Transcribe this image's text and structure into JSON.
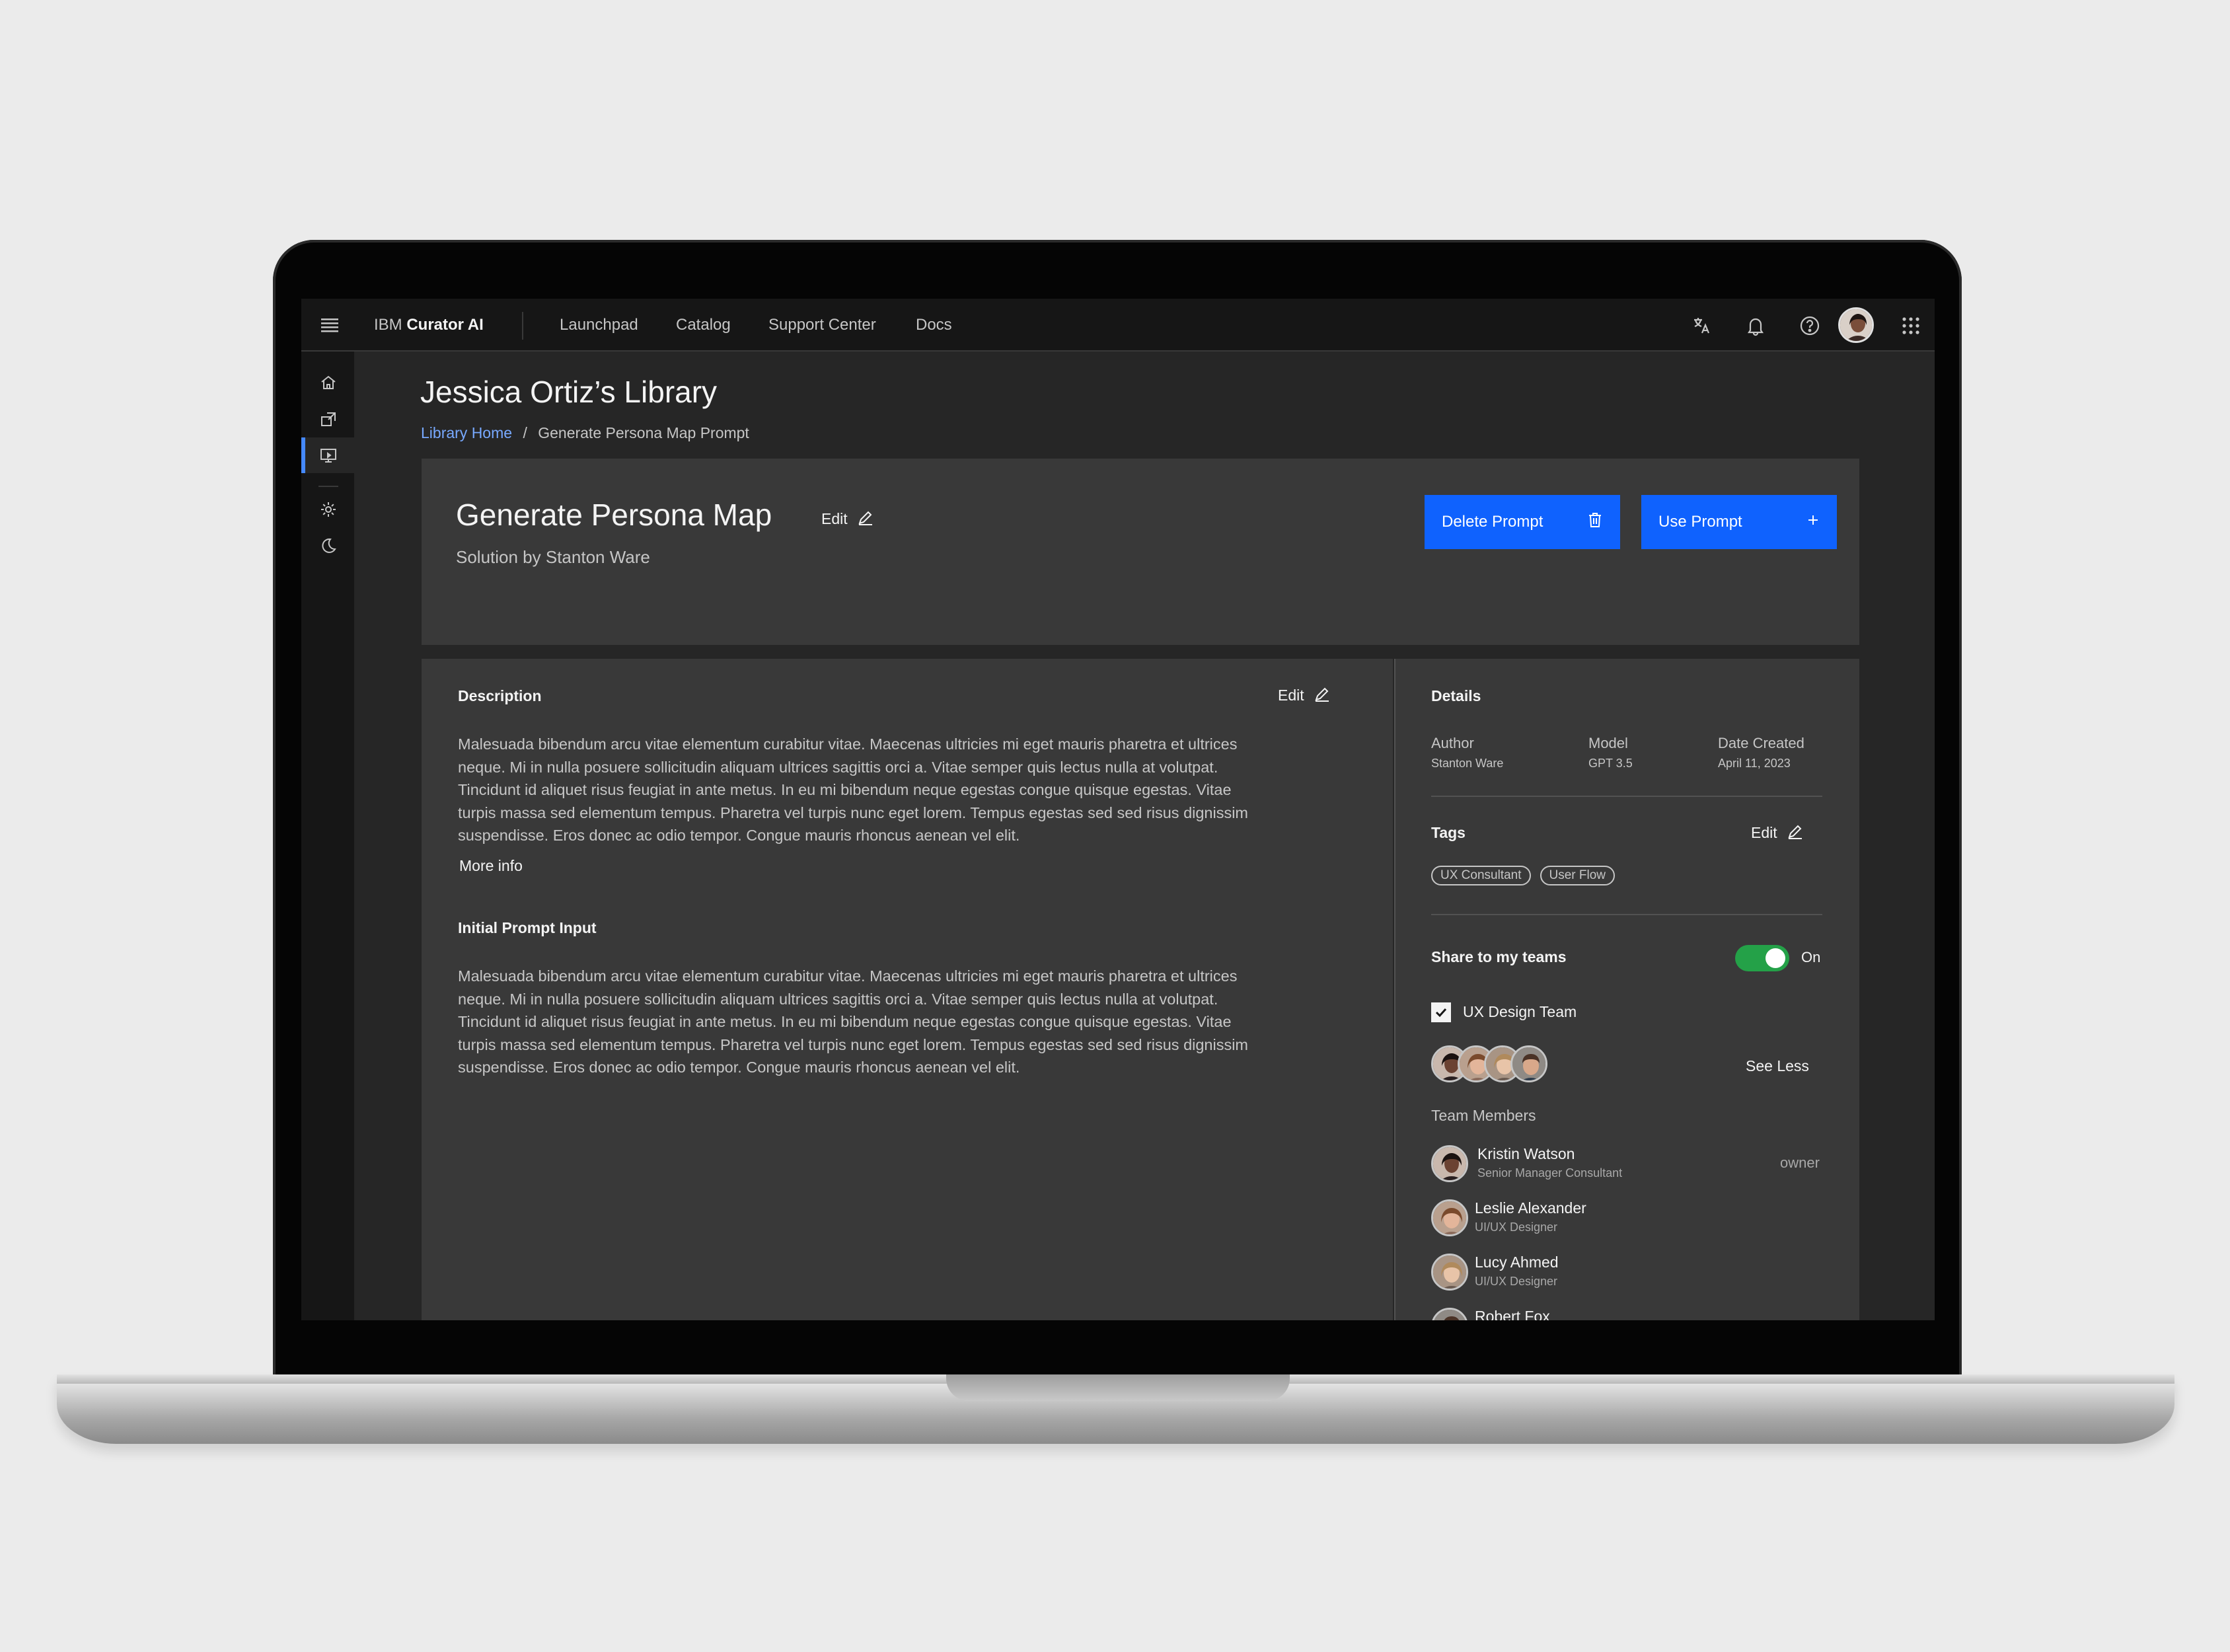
{
  "header": {
    "brand_prefix": "IBM",
    "brand_name": "Curator AI",
    "nav": [
      "Launchpad",
      "Catalog",
      "Support Center",
      "Docs"
    ]
  },
  "page": {
    "title": "Jessica Ortiz’s Library",
    "breadcrumb_home": "Library Home",
    "breadcrumb_sep": "/",
    "breadcrumb_current": "Generate Persona Map Prompt"
  },
  "prompt": {
    "title": "Generate Persona Map",
    "edit_label": "Edit",
    "subtitle": "Solution by Stanton Ware",
    "delete_label": "Delete Prompt",
    "use_label": "Use Prompt"
  },
  "description": {
    "heading": "Description",
    "edit_label": "Edit",
    "body": "Malesuada bibendum arcu vitae elementum curabitur vitae. Maecenas ultricies mi eget mauris pharetra et ultrices neque. Mi in nulla posuere sollicitudin aliquam ultrices sagittis orci a. Vitae semper quis lectus nulla at volutpat. Tincidunt id aliquet risus feugiat in ante metus. In eu mi bibendum neque egestas congue quisque egestas. Vitae turpis massa sed elementum tempus. Pharetra vel turpis nunc eget lorem. Tempus egestas sed sed risus dignissim suspendisse. Eros donec ac odio tempor. Congue mauris rhoncus aenean vel elit.",
    "more_info": "More info",
    "initial_heading": "Initial Prompt Input",
    "initial_body": "Malesuada bibendum arcu vitae elementum curabitur vitae. Maecenas ultricies mi eget mauris pharetra et ultrices neque. Mi in nulla posuere sollicitudin aliquam ultrices sagittis orci a. Vitae semper quis lectus nulla at volutpat. Tincidunt id aliquet risus feugiat in ante metus. In eu mi bibendum neque egestas congue quisque egestas. Vitae turpis massa sed elementum tempus. Pharetra vel turpis nunc eget lorem. Tempus egestas sed sed risus dignissim suspendisse. Eros donec ac odio tempor. Congue mauris rhoncus aenean vel elit."
  },
  "details": {
    "heading": "Details",
    "author_label": "Author",
    "author_value": "Stanton Ware",
    "model_label": "Model",
    "model_value": "GPT 3.5",
    "date_label": "Date Created",
    "date_value": "April 11, 2023",
    "tags_heading": "Tags",
    "tags_edit": "Edit",
    "tags": [
      "UX Consultant",
      "User Flow"
    ],
    "share_label": "Share to my teams",
    "share_state": "On",
    "team_name": "UX Design Team",
    "see_less": "See Less",
    "members_heading": "Team Members",
    "members": [
      {
        "name": "Kristin Watson",
        "role": "Senior Manager Consultant",
        "badge": "owner"
      },
      {
        "name": "Leslie Alexander",
        "role": "UI/UX Designer"
      },
      {
        "name": "Lucy Ahmed",
        "role": "UI/UX Designer"
      },
      {
        "name": "Robert Fox",
        "role": ""
      }
    ]
  },
  "colors": {
    "accent": "#0f62fe",
    "toggle_on": "#24a148",
    "link": "#78a9ff"
  }
}
